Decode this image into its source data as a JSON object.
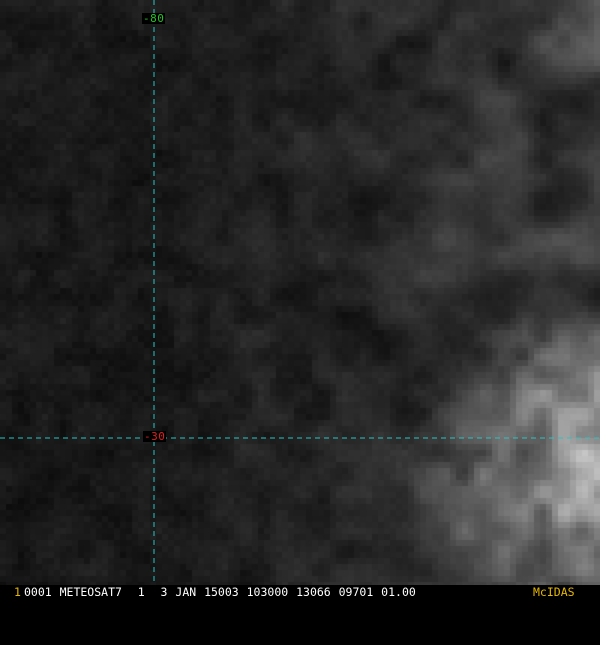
{
  "graticule": {
    "longitude_label": "-80",
    "latitude_label": "-30",
    "line_color": "#29c4c4",
    "longitude_label_color": "#29c429",
    "latitude_label_color": "#e02020"
  },
  "imagery": {
    "satellite": "METEOSAT7",
    "band": "1",
    "scene": "cloud field over dark ocean, brighter convective cloud at lower right"
  },
  "status_bar": {
    "frame_number": "1",
    "frame_color": "#e6b800",
    "text": "0001 METEOSAT7  1  3 JAN 15003 103000 13066 09701 01.00",
    "text_color": "#ffffff",
    "brand": "McIDAS",
    "brand_color": "#e6b800"
  }
}
